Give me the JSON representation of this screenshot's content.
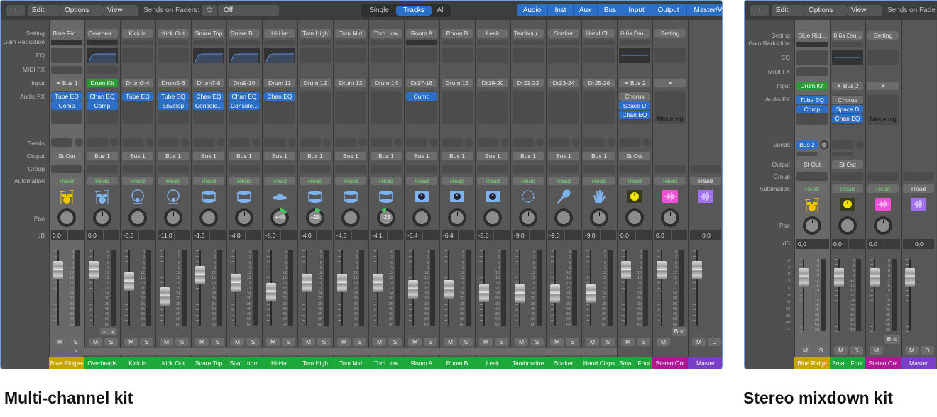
{
  "colors": {
    "accent": "#2c6fc7",
    "green": "#2b9c35",
    "track_green": "#1fa83a",
    "track_yellow": "#c9a400",
    "track_magenta": "#b0189c",
    "track_purple": "#7b3fc6",
    "read_text": "#6fd66f"
  },
  "row_labels": [
    "Setting",
    "Gain Reduction",
    "EQ",
    "MIDI FX",
    "Input",
    "Audio FX",
    "Sends",
    "Output",
    "Group",
    "Automation",
    "Pan",
    "dB"
  ],
  "meter_scale": [
    "0",
    "3",
    "6",
    "9",
    "12",
    "15",
    "18",
    "21",
    "24",
    "30",
    "35",
    "40",
    "45",
    "50",
    "60"
  ],
  "fader_scale": [
    "6",
    "3",
    "0",
    "3",
    "6",
    "10",
    "15",
    "20",
    "30",
    "40",
    "∞"
  ],
  "captions": {
    "left": "Multi-channel kit",
    "right": "Stereo mixdown kit"
  },
  "mixers": [
    {
      "toolbar": {
        "back_icon": "up-arrow-icon",
        "edit": "Edit",
        "options": "Options",
        "view": "View",
        "sends_label": "Sends on Faders:",
        "sends_power_icon": "power-icon",
        "sends_value": "Off",
        "modes": [
          "Single",
          "Tracks",
          "All"
        ],
        "active_mode": "Tracks",
        "filters": [
          "Audio",
          "Inst",
          "Aux",
          "Bus",
          "Input",
          "Output",
          "Master/V"
        ]
      },
      "channels": [
        {
          "setting": "Blue Rid...",
          "gain": true,
          "eq": "none",
          "midi": true,
          "input": "Bus 1",
          "input_link": true,
          "fx": [
            "Tube EQ",
            "Comp"
          ],
          "output": "St Out",
          "auto": "Read",
          "icon": "drum-kit",
          "icon_color": "#f0c400",
          "pan": 0,
          "db": "0,0",
          "fader_db": 0,
          "name": "Blue Ridge+",
          "name_color": "#c9a400",
          "selected": true
        },
        {
          "setting": "Overhea...",
          "gain": true,
          "eq": "curve",
          "midi": true,
          "input": "Drum Kit",
          "input_green": true,
          "fx": [
            "Chan EQ",
            "Comp"
          ],
          "output": "Bus 1",
          "auto": "Read",
          "icon": "drum-kit",
          "icon_color": "#7fb3f0",
          "pan": 0,
          "db": "0,0",
          "fader_db": 0,
          "name": "Overheads",
          "name_color": "#1fa83a"
        },
        {
          "setting": "Kick In",
          "input": "Drum3-4",
          "fx": [
            "Tube EQ"
          ],
          "output": "Bus 1",
          "auto": "Read",
          "icon": "kick-drum",
          "icon_color": "#7fb3f0",
          "pan": 0,
          "db": "-3,5",
          "fader_db": -3.5,
          "name": "Kick In",
          "name_color": "#1fa83a"
        },
        {
          "setting": "Kick Out",
          "input": "Drum5-6",
          "fx": [
            "Tube EQ",
            "Envelop"
          ],
          "output": "Bus 1",
          "auto": "Read",
          "icon": "kick-drum",
          "icon_color": "#7fb3f0",
          "pan": 0,
          "db": "-11,0",
          "fader_db": -11,
          "name": "Kick Out",
          "name_color": "#1fa83a"
        },
        {
          "setting": "Snare Top",
          "eq": "curve",
          "input": "Drum7-8",
          "fx": [
            "Chan EQ",
            "Console..."
          ],
          "output": "Bus 1",
          "auto": "Read",
          "icon": "snare-drum",
          "icon_color": "#7fb3f0",
          "pan": 0,
          "db": "-1,5",
          "fader_db": -1.5,
          "name": "Snare Top",
          "name_color": "#1fa83a"
        },
        {
          "setting": "Snare B...",
          "eq": "curve",
          "input": "Dru9-10",
          "fx": [
            "Chan EQ",
            "Console..."
          ],
          "output": "Bus 1",
          "auto": "Read",
          "icon": "snare-drum",
          "icon_color": "#7fb3f0",
          "pan": 0,
          "db": "-4,0",
          "fader_db": -4,
          "name": "Snar...ttom",
          "name_color": "#1fa83a"
        },
        {
          "setting": "Hi-Hat",
          "eq": "curve",
          "input": "Drum 11",
          "fx": [
            "Chan EQ"
          ],
          "output": "Bus 1",
          "auto": "Read",
          "icon": "hi-hat",
          "icon_color": "#7fb3f0",
          "pan": 40,
          "db": "-8,0",
          "fader_db": -8,
          "name": "Hi-Hat",
          "name_color": "#1fa83a"
        },
        {
          "setting": "Tom High",
          "input": "Drum 12",
          "fx": [],
          "output": "Bus 1",
          "auto": "Read",
          "icon": "tom",
          "icon_color": "#7fb3f0",
          "pan": 29,
          "db": "-4,0",
          "fader_db": -4,
          "name": "Tom High",
          "name_color": "#1fa83a"
        },
        {
          "setting": "Tom Mid",
          "input": "Drum 13",
          "fx": [],
          "output": "Bus 1",
          "auto": "Read",
          "icon": "tom",
          "icon_color": "#7fb3f0",
          "pan": 0,
          "db": "-4,0",
          "fader_db": -4,
          "name": "Tom Mid",
          "name_color": "#1fa83a"
        },
        {
          "setting": "Tom Low",
          "input": "Drum 14",
          "fx": [],
          "output": "Bus 1",
          "auto": "Read",
          "icon": "floor-tom",
          "icon_color": "#7fb3f0",
          "pan": -23,
          "db": "-4,1",
          "fader_db": -4.1,
          "name": "Tom Low",
          "name_color": "#1fa83a"
        },
        {
          "setting": "Room A",
          "gain": true,
          "input": "Dr17-18",
          "fx": [
            "Comp"
          ],
          "output": "Bus 1",
          "auto": "Read",
          "icon": "room-mic",
          "icon_color": "#7fb3f0",
          "pan": 0,
          "db": "-6,4",
          "fader_db": -6.4,
          "name": "Room A",
          "name_color": "#1fa83a"
        },
        {
          "setting": "Room B",
          "input": "Drum 16",
          "fx": [],
          "output": "Bus 1",
          "auto": "Read",
          "icon": "room-mic",
          "icon_color": "#7fb3f0",
          "pan": 0,
          "db": "-6,4",
          "fader_db": -6.4,
          "name": "Room B",
          "name_color": "#1fa83a"
        },
        {
          "setting": "Leak",
          "input": "Dr19-20",
          "fx": [],
          "output": "Bus 1",
          "auto": "Read",
          "icon": "room-mic",
          "icon_color": "#7fb3f0",
          "pan": 0,
          "db": "-8,6",
          "fader_db": -8.6,
          "name": "Leak",
          "name_color": "#1fa83a"
        },
        {
          "setting": "Tambour...",
          "input": "Dr21-22",
          "fx": [],
          "output": "Bus 1",
          "auto": "Read",
          "icon": "tambourine",
          "icon_color": "#7fb3f0",
          "pan": 0,
          "db": "-9,0",
          "fader_db": -9,
          "name": "Tambourine",
          "name_color": "#1fa83a"
        },
        {
          "setting": "Shaker",
          "input": "Dr23-24",
          "fx": [],
          "output": "Bus 1",
          "auto": "Read",
          "icon": "shaker",
          "icon_color": "#7fb3f0",
          "pan": 0,
          "db": "-9,0",
          "fader_db": -9,
          "name": "Shaker",
          "name_color": "#1fa83a"
        },
        {
          "setting": "Hand Cl...",
          "input": "Dr25-26",
          "fx": [],
          "output": "Bus 1",
          "auto": "Read",
          "icon": "hand-clap",
          "icon_color": "#7fb3f0",
          "pan": 0,
          "db": "-9,0",
          "fader_db": -9,
          "name": "Hand Claps",
          "name_color": "#1fa83a"
        },
        {
          "setting": "0.6s Dru...",
          "eq": "line",
          "input": "Bus 2",
          "input_link": true,
          "fx": [
            "Chorus",
            "Space D",
            "Chan EQ"
          ],
          "fx_gray": [
            0
          ],
          "output": "St Out",
          "auto": "Read",
          "icon": "aux-knob",
          "icon_color": "#f0e000",
          "pan": 0,
          "db": "0,0",
          "fader_db": 0,
          "name": "Smal...Four",
          "name_color": "#1fa83a",
          "aux": true
        },
        {
          "setting": "Setting",
          "input": "",
          "input_link": true,
          "fx": [],
          "fx_note": "Mastering",
          "auto": "Read",
          "icon": "stereo-out-waveform",
          "icon_color": "#f050d8",
          "pan": 0,
          "db": "0,0",
          "fader_db": 0,
          "name": "Stereo Out",
          "name_color": "#b0189c",
          "bnc": "Bnc",
          "buttons": [
            "M"
          ],
          "out": true
        },
        {
          "auto": "Read",
          "auto_white": true,
          "icon": "master-waveform",
          "icon_color": "#a070f0",
          "db": "0,0",
          "db_single": true,
          "fader_db": 0,
          "name": "Master",
          "name_color": "#7b3fc6",
          "buttons": [
            "M",
            "D"
          ],
          "master": true,
          "nopan": true
        }
      ],
      "plus_minus": [
        "−",
        "+"
      ],
      "scroll_arrow": "›"
    },
    {
      "toolbar": {
        "back_icon": "up-arrow-icon",
        "edit": "Edit",
        "options": "Options",
        "view": "View",
        "sends_label": "Sends on Fade"
      },
      "channels": [
        {
          "setting": "Blue Rid...",
          "gain": true,
          "eq": "none",
          "midi": true,
          "input": "Drum Kit",
          "input_green": true,
          "fx": [
            "Tube EQ",
            "Comp"
          ],
          "send": "Bus 2",
          "output": "St Out",
          "auto": "Read",
          "icon": "drum-kit",
          "icon_color": "#f0c400",
          "pan": 0,
          "db": "0,0",
          "fader_db": 0,
          "name": "Blue Ridge",
          "name_color": "#c9a400",
          "selected": true
        },
        {
          "setting": "0.6s Dru...",
          "eq": "line",
          "input": "Bus 2",
          "input_link": true,
          "fx": [
            "Chorus",
            "Space D",
            "Chan EQ"
          ],
          "fx_gray": [
            0
          ],
          "output": "St Out",
          "auto": "Read",
          "icon": "aux-knob",
          "icon_color": "#f0e000",
          "pan": 0,
          "db": "0,0",
          "fader_db": 0,
          "name": "Smal...Four",
          "name_color": "#1fa83a"
        },
        {
          "setting": "Setting",
          "input": "",
          "input_link": true,
          "fx": [],
          "fx_note": "Mastering",
          "auto": "Read",
          "icon": "stereo-out-waveform",
          "icon_color": "#f050d8",
          "pan": 0,
          "db": "0,0",
          "fader_db": 0,
          "name": "Stereo Out",
          "name_color": "#b0189c",
          "bnc": "Bnc",
          "buttons": [
            "M"
          ],
          "out": true
        },
        {
          "auto": "Read",
          "auto_white": true,
          "icon": "master-waveform",
          "icon_color": "#a070f0",
          "db": "0,0",
          "db_single": true,
          "fader_db": 0,
          "name": "Master",
          "name_color": "#7b3fc6",
          "buttons": [
            "M",
            "D"
          ],
          "master": true,
          "nopan": true
        }
      ]
    }
  ]
}
